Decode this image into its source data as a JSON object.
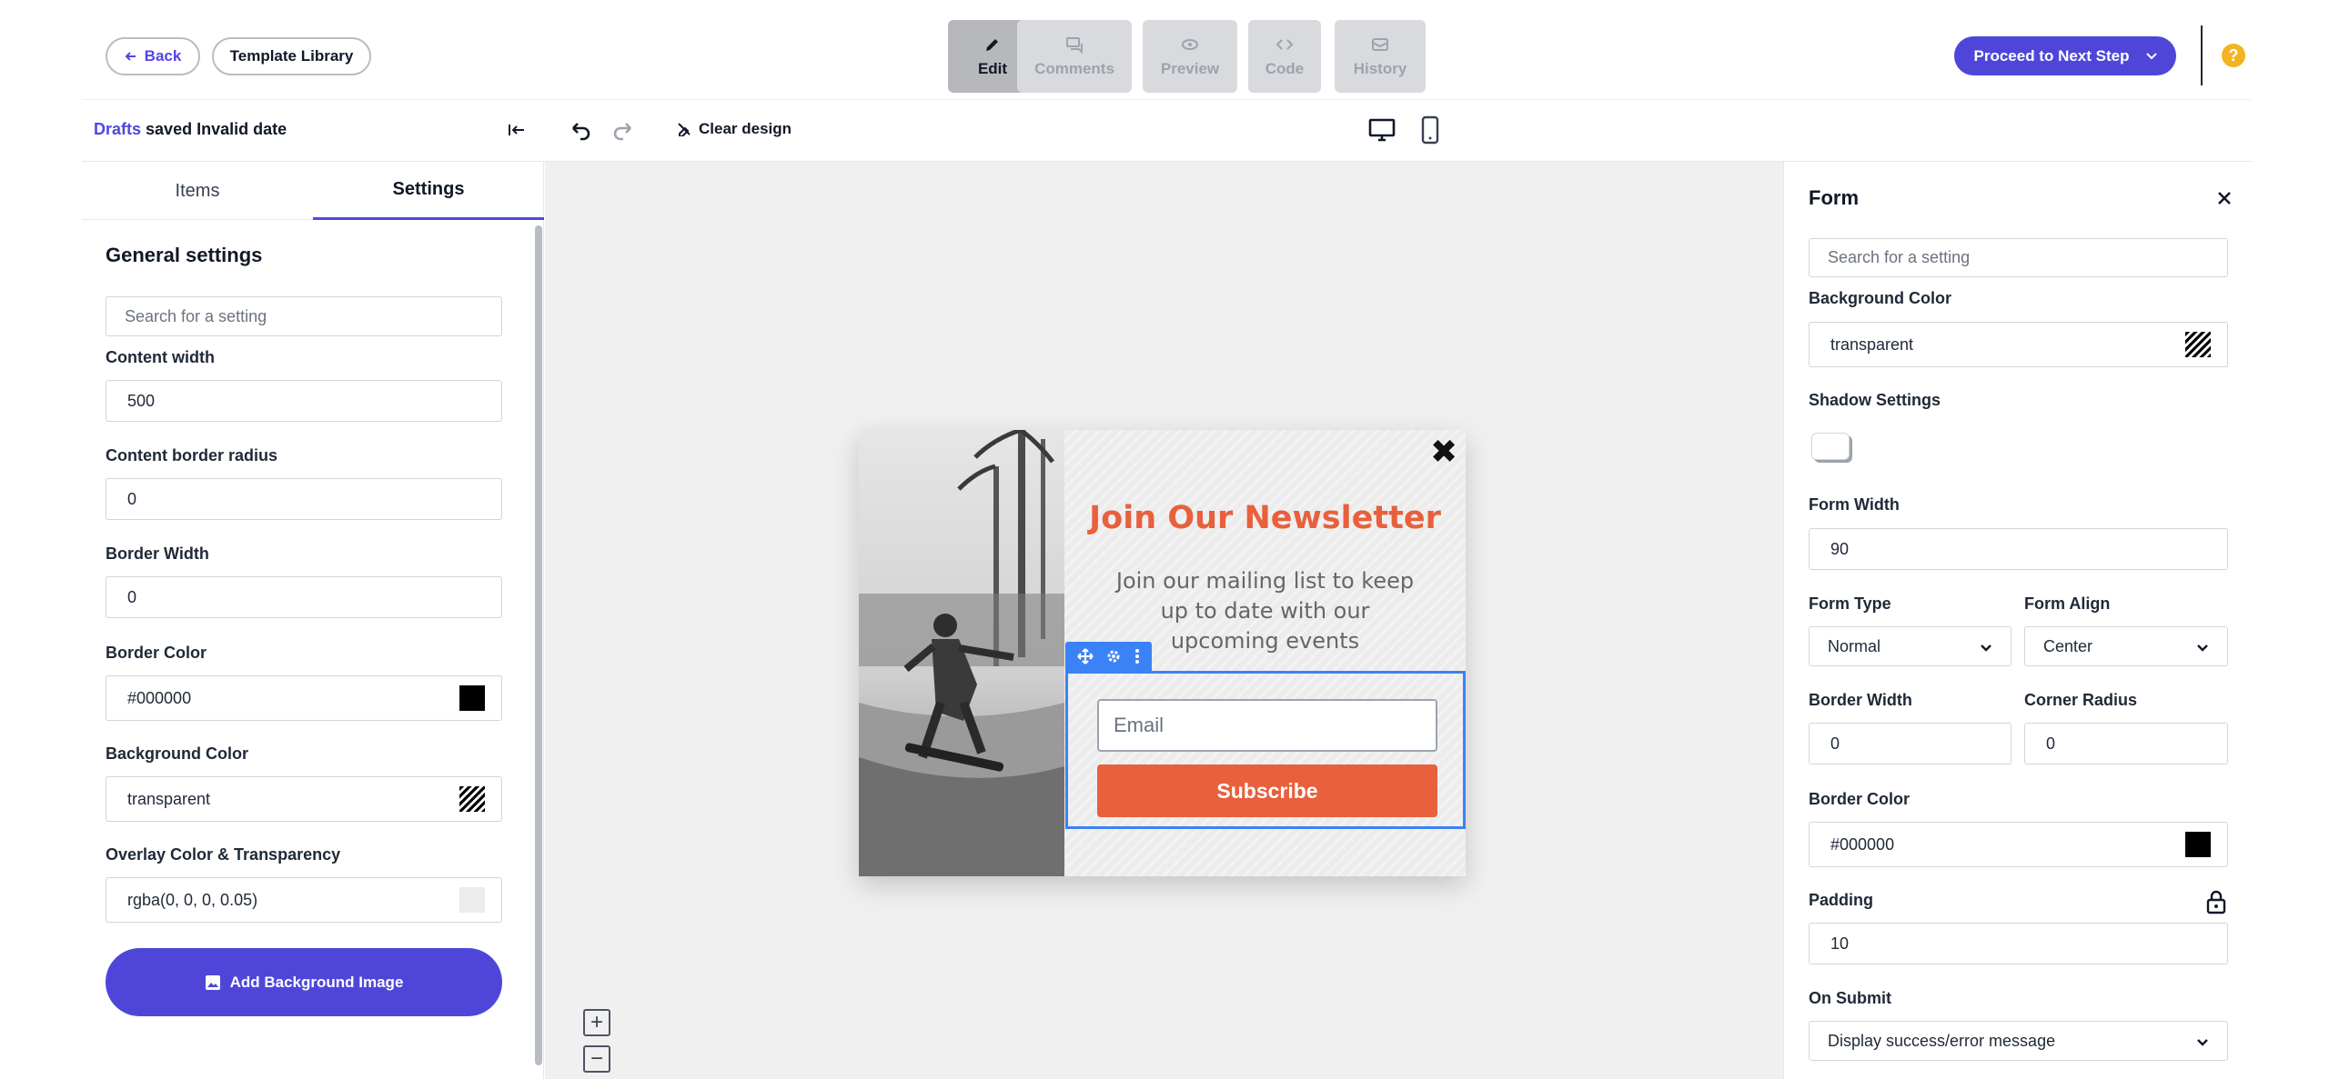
{
  "header": {
    "back_label": "Back",
    "template_library_label": "Template Library",
    "modes": [
      {
        "label": "Edit"
      },
      {
        "label": "Comments"
      },
      {
        "label": "Preview"
      },
      {
        "label": "Code"
      },
      {
        "label": "History"
      }
    ],
    "proceed_label": "Proceed to Next Step",
    "help_icon": "?"
  },
  "subbar": {
    "drafts_link": "Drafts",
    "drafts_status": "saved Invalid date",
    "clear_design_label": "Clear design"
  },
  "left_panel": {
    "tabs": [
      "Items",
      "Settings"
    ],
    "active_tab": "Settings",
    "section_title": "General settings",
    "search_placeholder": "Search for a setting",
    "content_width_label": "Content width",
    "content_width_value": "500",
    "content_border_radius_label": "Content border radius",
    "content_border_radius_value": "0",
    "border_width_label": "Border Width",
    "border_width_value": "0",
    "border_color_label": "Border Color",
    "border_color_value": "#000000",
    "background_color_label": "Background Color",
    "background_color_value": "transparent",
    "overlay_label": "Overlay Color & Transparency",
    "overlay_value": "rgba(0, 0, 0, 0.05)",
    "add_bg_image_label": "Add Background Image"
  },
  "popup": {
    "close_symbol": "✖",
    "title": "Join Our Newsletter",
    "body": "Join our mailing list to keep up to date with our upcoming events",
    "email_placeholder": "Email",
    "subscribe_label": "Subscribe"
  },
  "zoom": {
    "in": "+",
    "out": "−"
  },
  "right_panel": {
    "title": "Form",
    "search_placeholder": "Search for a setting",
    "background_color_label": "Background Color",
    "background_color_value": "transparent",
    "shadow_label": "Shadow Settings",
    "form_width_label": "Form Width",
    "form_width_value": "90",
    "form_type_label": "Form Type",
    "form_type_value": "Normal",
    "form_align_label": "Form Align",
    "form_align_value": "Center",
    "border_width_label": "Border Width",
    "border_width_value": "0",
    "corner_radius_label": "Corner Radius",
    "corner_radius_value": "0",
    "border_color_label": "Border Color",
    "border_color_value": "#000000",
    "padding_label": "Padding",
    "padding_value": "10",
    "on_submit_label": "On Submit",
    "on_submit_value": "Display success/error message"
  },
  "colors": {
    "accent": "#4f46d9",
    "popup_orange": "#e8603c",
    "selection_blue": "#3b82f6",
    "help_yellow": "#f4b322"
  },
  "icons": [
    "arrow-left-icon",
    "pencil-icon",
    "comment-icon",
    "eye-icon",
    "code-icon",
    "envelope-icon",
    "chevron-down-icon",
    "collapse-left-icon",
    "undo-icon",
    "redo-icon",
    "paint-off-icon",
    "desktop-icon",
    "mobile-icon",
    "image-icon",
    "move-icon",
    "gear-icon",
    "more-vertical-icon",
    "close-icon",
    "lock-icon"
  ]
}
